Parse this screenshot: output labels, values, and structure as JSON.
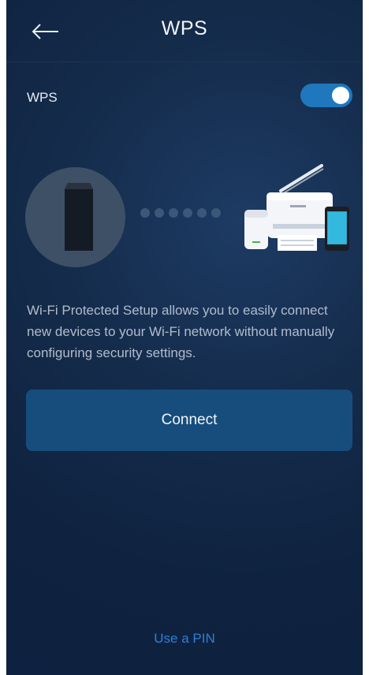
{
  "header": {
    "title": "WPS",
    "back_icon": "back-arrow-icon"
  },
  "wps": {
    "label": "WPS",
    "enabled": true
  },
  "illustration": {
    "router_icon": "router-icon",
    "dots_count": 6,
    "devices_icon": "devices-icon"
  },
  "description": "Wi-Fi Protected Setup allows you to easily connect new devices to your Wi-Fi network without manually configuring security settings.",
  "connect_button": {
    "label": "Connect"
  },
  "pin_link": {
    "label": "Use a PIN"
  },
  "colors": {
    "background": "#0f2340",
    "accent": "#1f77bd",
    "button": "#174d7c",
    "link": "#2f7fd1"
  }
}
